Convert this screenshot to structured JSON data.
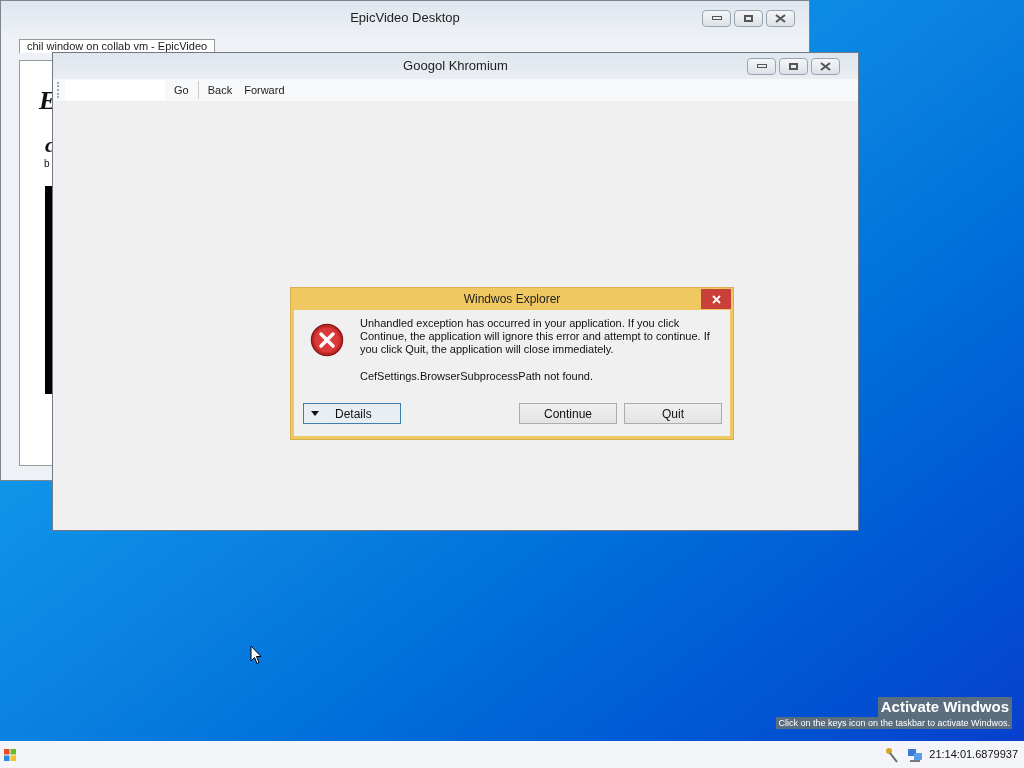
{
  "back_window": {
    "title": "EpicVideo Desktop",
    "tab_label": "chil window on collab vm - EpicVideo",
    "heading": "E",
    "subheading": "c",
    "text": "b"
  },
  "browser_window": {
    "title": "Googol Khromium",
    "toolbar": [
      "Go",
      "Back",
      "Forward"
    ]
  },
  "dialog": {
    "title": "Windwos Explorer",
    "message": "Unhandled exception has occurred in your application. If you click Continue, the application will ignore this error and attempt to continue. If you click Quit, the application will close immediately.",
    "detail": "CefSettings.BrowserSubprocessPath not found.",
    "details_button": "Details",
    "buttons": [
      "Continue",
      "Quit"
    ]
  },
  "activation": {
    "title": "Activate Windwos",
    "message": "Click on the keys icon on the taskbar to activate Windwos."
  },
  "taskbar": {
    "clock": "21:14:01.6879937"
  }
}
